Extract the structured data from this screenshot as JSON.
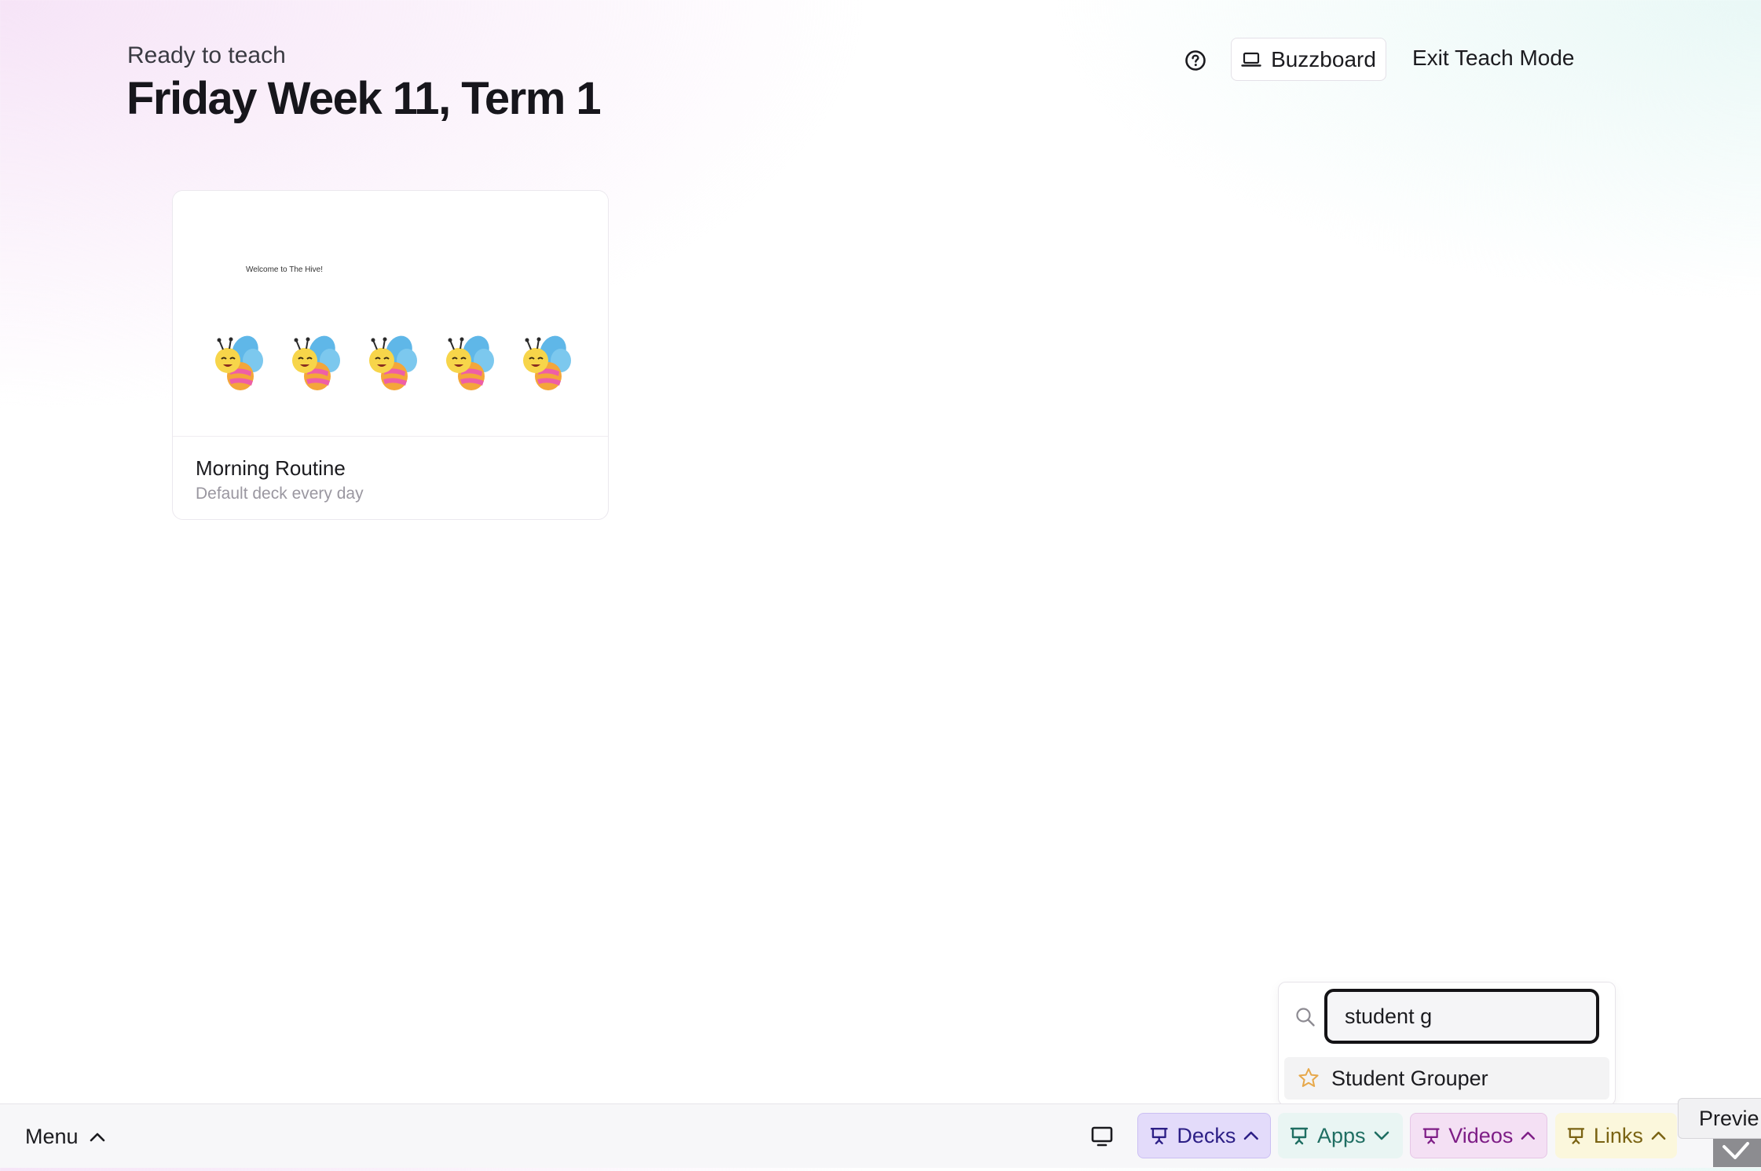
{
  "header": {
    "eyebrow": "Ready to teach",
    "title": "Friday Week 11, Term 1",
    "help_icon": "help-circle-icon",
    "buzzboard_label": "Buzzboard",
    "buzzboard_icon": "laptop-icon",
    "exit_label": "Exit Teach Mode"
  },
  "deck_card": {
    "thumbnail_text": "Welcome to The Hive!",
    "title": "Morning Routine",
    "subtitle": "Default deck every day",
    "thumbnail_icon": "bee-icon",
    "bee_count": 5
  },
  "search": {
    "value": "student g",
    "icon": "search-icon",
    "results": [
      {
        "label": "Student Grouper",
        "icon": "star-icon"
      }
    ]
  },
  "bottom_bar": {
    "menu_label": "Menu",
    "screen_icon": "monitor-icon",
    "tabs": [
      {
        "label": "Decks",
        "chevron": "up",
        "color": "#2c1f86"
      },
      {
        "label": "Apps",
        "chevron": "down",
        "color": "#1f6e62"
      },
      {
        "label": "Videos",
        "chevron": "up",
        "color": "#7e1d86"
      },
      {
        "label": "Links",
        "chevron": "up",
        "color": "#7a6313"
      }
    ],
    "preview_label": "Previe"
  }
}
